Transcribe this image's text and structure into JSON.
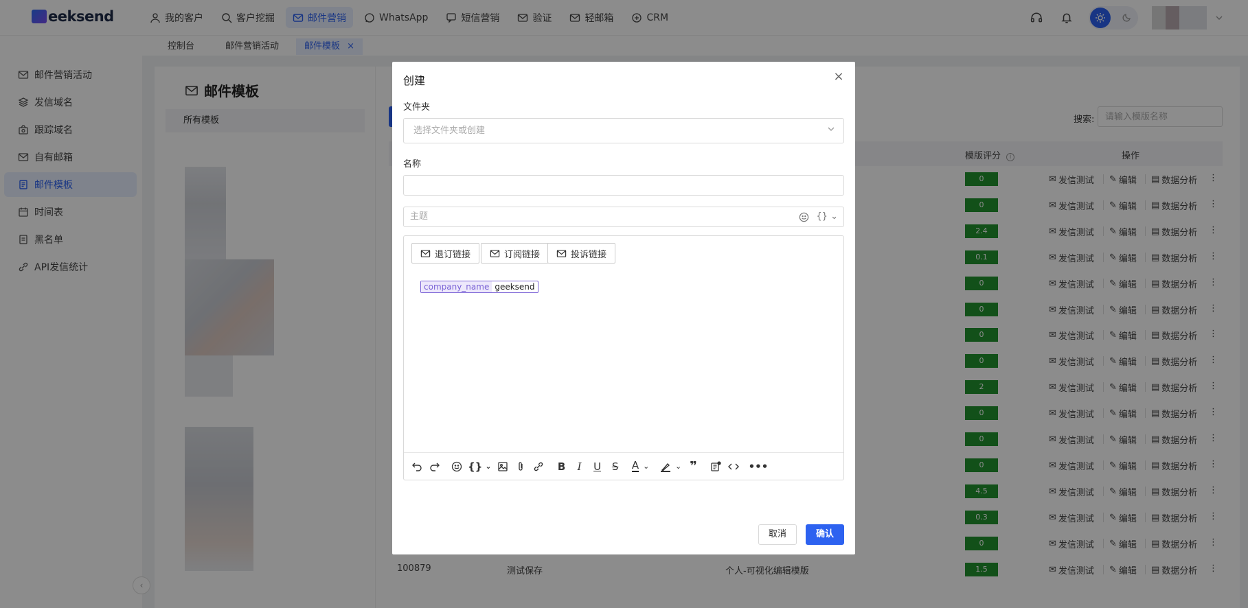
{
  "brand": {
    "logo_text": "eeksend",
    "accent": "#2d62f0"
  },
  "nav": {
    "items": [
      {
        "label": "我的客户",
        "icon": "user-icon"
      },
      {
        "label": "客户挖掘",
        "icon": "search-icon"
      },
      {
        "label": "邮件营销",
        "icon": "mail-icon",
        "active": true
      },
      {
        "label": "WhatsApp",
        "icon": "whatsapp-icon"
      },
      {
        "label": "短信营销",
        "icon": "sms-icon"
      },
      {
        "label": "验证",
        "icon": "verify-mail-icon"
      },
      {
        "label": "轻邮箱",
        "icon": "light-mail-icon"
      },
      {
        "label": "CRM",
        "icon": "crm-icon"
      }
    ]
  },
  "subtabs": [
    {
      "label": "控制台"
    },
    {
      "label": "邮件营销活动"
    },
    {
      "label": "邮件模板",
      "active": true,
      "close": "×"
    }
  ],
  "sidebar": {
    "items": [
      {
        "label": "邮件营销活动",
        "icon": "campaign-icon"
      },
      {
        "label": "发信域名",
        "icon": "domain-icon"
      },
      {
        "label": "跟踪域名",
        "icon": "tracking-icon"
      },
      {
        "label": "自有邮箱",
        "icon": "mailbox-icon"
      },
      {
        "label": "邮件模板",
        "icon": "template-icon",
        "active": true
      },
      {
        "label": "时间表",
        "icon": "schedule-icon"
      },
      {
        "label": "黑名单",
        "icon": "blacklist-icon"
      },
      {
        "label": "API发信统计",
        "icon": "api-icon"
      }
    ],
    "collapse": "‹"
  },
  "templates_panel": {
    "title": "邮件模板",
    "all_templates": "所有模板"
  },
  "search": {
    "label": "搜索:",
    "placeholder": "请输入模版名称"
  },
  "table": {
    "headers": {
      "score": "模版评分",
      "actions": "操作"
    },
    "actions": {
      "send_test": "发信测试",
      "edit": "编辑",
      "analytics": "数据分析",
      "more": "⋮"
    },
    "scores": [
      "0",
      "0",
      "2.4",
      "0.1",
      "0",
      "0",
      "0",
      "0",
      "2",
      "0",
      "0",
      "0",
      "4.5",
      "0.3",
      "0",
      "1.5"
    ],
    "last_row": {
      "id": "100879",
      "name": "测试保存",
      "type": "个人-可视化编辑模版"
    }
  },
  "modal": {
    "title": "创建",
    "close": "×",
    "folder_label": "文件夹",
    "folder_placeholder": "选择文件夹或创建",
    "name_label": "名称",
    "name_value": "",
    "subject_placeholder": "主题",
    "subject_var": "{}",
    "link_buttons": [
      "退订链接",
      "订阅链接",
      "投诉链接"
    ],
    "token": {
      "key": "company_name",
      "value": "geeksend"
    },
    "cancel": "取消",
    "confirm": "确认"
  },
  "toolbar": {
    "icons": [
      "undo-icon",
      "redo-icon",
      "emoji-icon",
      "variable-icon",
      "image-icon",
      "attachment-icon",
      "link-icon",
      "bold-icon",
      "italic-icon",
      "underline-icon",
      "strikethrough-icon",
      "font-color-icon",
      "highlight-icon",
      "quote-icon",
      "template-insert-icon",
      "code-icon",
      "more-icon"
    ]
  }
}
